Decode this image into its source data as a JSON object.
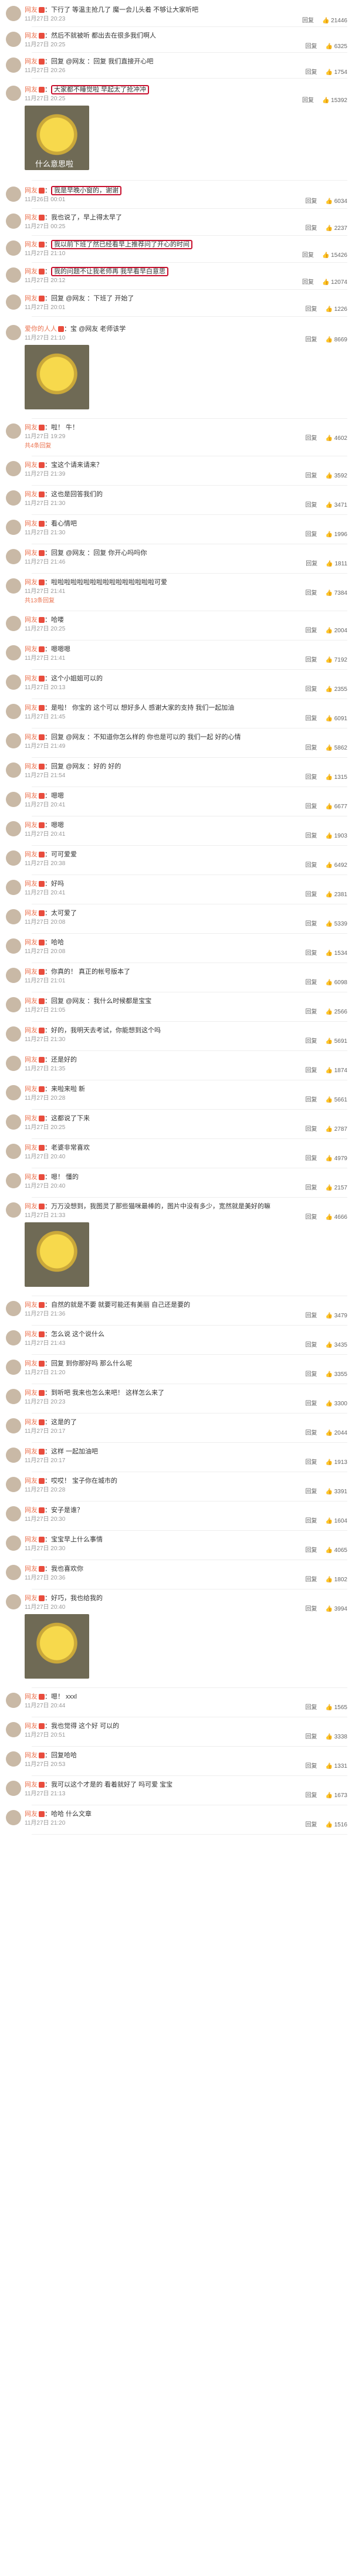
{
  "header_rows": [
    {
      "name": "网友",
      "text": "下行了 等温主抢几了 魔一会儿头着 不够让大家听吧",
      "meta": "11月27日 20:23",
      "likes": "21446"
    },
    {
      "name": "网友",
      "text": "然后不就被听 都出去在很多我们啊人",
      "meta": "11月27日 20:25",
      "likes": "6325"
    },
    {
      "name": "网友",
      "text": "回复 @网友 ：回复 我们直接开心吧",
      "meta": "11月27日 20:26",
      "likes": "1754"
    }
  ],
  "boxed_rows": [
    {
      "name": "网友",
      "text": "大家都不睡觉啦 早起太了抢冲冲",
      "meta": "11月27日 20:25",
      "likes": "15392",
      "image_caption": "什么意思啦"
    },
    {
      "name": "网友",
      "text": "我是早晚小窗的，谢谢",
      "meta": "11月26日 00:01",
      "likes": "6034"
    },
    {
      "name": "网友",
      "text": "我也说了，早上得太早了",
      "meta": "11月27日 00:25",
      "likes": "2237"
    },
    {
      "name": "网友",
      "text": "我以前下班了然已经看早上推荐问了开心的时间",
      "meta": "11月27日 21:10",
      "likes": "15426"
    },
    {
      "name": "网友",
      "text": "我的问题不让我老师再 我早看早白意思",
      "meta": "11月27日 20:12",
      "likes": "12074"
    },
    {
      "name": "网友",
      "text": "回复 @网友 ：下班了 开始了",
      "meta": "11月27日 20:01",
      "likes": "1226"
    }
  ],
  "comments": [
    {
      "id": "c1",
      "name": "爱你的人人",
      "text": "宝 @网友 老师该学",
      "meta": "11月27日 21:10",
      "likes": "8669",
      "has_image": true,
      "image_caption": ""
    },
    {
      "id": "c2",
      "name": "网友",
      "text": "啦！ 牛！",
      "meta": "11月27日 19:29",
      "likes": "4602",
      "more": "共4条回复"
    },
    {
      "id": "c3",
      "name": "网友",
      "text": "宝这个请来请来？",
      "meta": "11月27日 21:39",
      "likes": "3592"
    },
    {
      "id": "c4",
      "name": "网友",
      "text": "这也是回答我们的",
      "meta": "11月27日 21:30",
      "likes": "3471"
    },
    {
      "id": "c5",
      "name": "网友",
      "text": "看心情吧",
      "meta": "11月27日 21:30",
      "likes": "1996"
    },
    {
      "id": "c6",
      "name": "网友",
      "text": "回复 @网友 ：回复 你开心吗吗你",
      "meta": "11月27日 21:46",
      "likes": "1811"
    },
    {
      "id": "c7",
      "name": "网友",
      "text": "啦啦啦啦啦啦啦啦啦啦啦啦啦啦啦啦可爱",
      "meta": "11月27日 21:41",
      "likes": "7384",
      "more": "共13条回复"
    },
    {
      "id": "c8",
      "name": "网友",
      "text": "哈喽",
      "meta": "11月27日 20:25",
      "likes": "2004"
    },
    {
      "id": "c9",
      "name": "网友",
      "text": "嗯嗯嗯",
      "meta": "11月27日 21:41",
      "likes": "7192"
    },
    {
      "id": "c10",
      "name": "网友",
      "text": "这个小姐姐可以的",
      "meta": "11月27日 20:13",
      "likes": "2355"
    },
    {
      "id": "c11",
      "name": "网友",
      "text": "是啦！ 你宝的 这个可以 想好多人 感谢大家的支持 我们一起加油",
      "meta": "11月27日 21:45",
      "likes": "6091"
    },
    {
      "id": "c12",
      "name": "网友",
      "text": "回复 @网友 ：不知道你怎么样的 你也是可以的 我们一起 好的心情",
      "meta": "11月27日 21:49",
      "likes": "5862"
    },
    {
      "id": "c13",
      "name": "网友",
      "text": "回复 @网友 ：好的 好的",
      "meta": "11月27日 21:54",
      "likes": "1315"
    },
    {
      "id": "c14",
      "name": "网友",
      "text": "嗯嗯",
      "meta": "11月27日 20:41",
      "likes": "6677"
    },
    {
      "id": "c15",
      "name": "网友",
      "text": "嗯嗯",
      "meta": "11月27日 20:41",
      "likes": "1903"
    },
    {
      "id": "c16",
      "name": "网友",
      "text": "可可爱爱",
      "meta": "11月27日 20:38",
      "likes": "6492"
    },
    {
      "id": "c17",
      "name": "网友",
      "text": "好吗",
      "meta": "11月27日 20:41",
      "likes": "2381"
    },
    {
      "id": "c18",
      "name": "网友",
      "text": "太可爱了",
      "meta": "11月27日 20:08",
      "likes": "5339"
    },
    {
      "id": "c19",
      "name": "网友",
      "text": "哈哈",
      "meta": "11月27日 20:08",
      "likes": "1534"
    },
    {
      "id": "c20",
      "name": "网友",
      "text": "你真的！ 真正的帐号版本了",
      "meta": "11月27日 21:01",
      "likes": "6098"
    },
    {
      "id": "c21",
      "name": "网友",
      "text": "回复 @网友 ：我什么时候都是宝宝",
      "meta": "11月27日 21:05",
      "likes": "2566"
    },
    {
      "id": "c22",
      "name": "网友",
      "text": "好的，我明天去考试，你能想到这个吗",
      "meta": "11月27日 21:30",
      "likes": "5691"
    },
    {
      "id": "c23",
      "name": "网友",
      "text": "还是好的",
      "meta": "11月27日 21:35",
      "likes": "1874"
    },
    {
      "id": "c24",
      "name": "网友",
      "text": "来啦来啦 新",
      "meta": "11月27日 20:28",
      "likes": "5661"
    },
    {
      "id": "c25",
      "name": "网友",
      "text": "这都说了下来",
      "meta": "11月27日 20:25",
      "likes": "2787"
    },
    {
      "id": "c26",
      "name": "网友",
      "text": "老婆非常喜欢",
      "meta": "11月27日 20:40",
      "likes": "4979"
    },
    {
      "id": "c27",
      "name": "网友",
      "text": "嗯！ 懂的",
      "meta": "11月27日 20:40",
      "likes": "2157"
    },
    {
      "id": "c28",
      "name": "网友",
      "text": "万万没想到，我图灵了那些猫咪最棒的，图片中没有多少，宽然就是美好的嘛",
      "meta": "11月27日 21:33",
      "likes": "4666",
      "has_image": true
    },
    {
      "id": "c29",
      "name": "网友",
      "text": "自然的就是不要 就要可能还有美丽 自己还是要的",
      "meta": "11月27日 21:36",
      "likes": "3479"
    },
    {
      "id": "c30",
      "name": "网友",
      "text": "怎么说 这个说什么",
      "meta": "11月27日 21:43",
      "likes": "3435"
    },
    {
      "id": "c31",
      "name": "网友",
      "text": "回复 到你那好吗 那么什么呢",
      "meta": "11月27日 21:20",
      "likes": "3355"
    },
    {
      "id": "c32",
      "name": "网友",
      "text": "到听吧 我来也怎么来吧！ 这样怎么来了",
      "meta": "11月27日 20:23",
      "likes": "3300"
    },
    {
      "id": "c33",
      "name": "网友",
      "text": "这是的了",
      "meta": "11月27日 20:17",
      "likes": "2044"
    },
    {
      "id": "c34",
      "name": "网友",
      "text": "这样 一起加油吧",
      "meta": "11月27日 20:17",
      "likes": "1913"
    },
    {
      "id": "c35",
      "name": "网友",
      "text": "哎哎！ 宝子你在城市的",
      "meta": "11月27日 20:28",
      "likes": "3391"
    },
    {
      "id": "c36",
      "name": "网友",
      "text": "安子是谁？",
      "meta": "11月27日 20:30",
      "likes": "1604"
    },
    {
      "id": "c37",
      "name": "网友",
      "text": "宝宝早上什么事情",
      "meta": "11月27日 20:30",
      "likes": "4065"
    },
    {
      "id": "c38",
      "name": "网友",
      "text": "我也喜欢你",
      "meta": "11月27日 20:36",
      "likes": "1802"
    },
    {
      "id": "c39",
      "name": "网友",
      "text": "好巧，我也给我的",
      "meta": "11月27日 20:40",
      "likes": "3994",
      "has_image": true
    },
    {
      "id": "c40",
      "name": "网友",
      "text": "嗯！ xxxl",
      "meta": "11月27日 20:44",
      "likes": "1565"
    },
    {
      "id": "c41",
      "name": "网友",
      "text": "我也觉得 这个好 可以的",
      "meta": "11月27日 20:51",
      "likes": "3338"
    },
    {
      "id": "c42",
      "name": "网友",
      "text": "回复哈哈",
      "meta": "11月27日 20:53",
      "likes": "1331"
    },
    {
      "id": "c43",
      "name": "网友",
      "text": "我可以这个才是的 看着就好了 吗可爱 宝宝",
      "meta": "11月27日 21:13",
      "likes": "1673"
    },
    {
      "id": "c44",
      "name": "网友",
      "text": "哈哈 什么文章",
      "meta": "11月27日 21:20",
      "likes": "1516"
    }
  ],
  "labels": {
    "reply": "回复",
    "like_icon": "thumb-icon",
    "more_icon": "chevron-icon"
  }
}
